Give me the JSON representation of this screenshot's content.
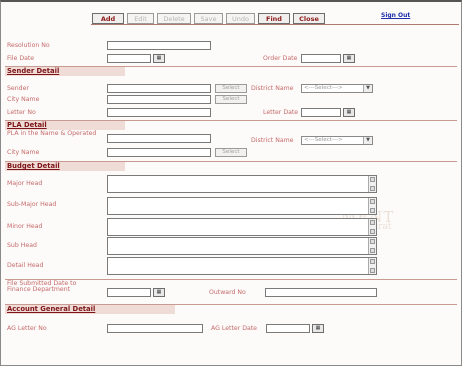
{
  "toolbar": {
    "add": "Add",
    "edit": "Edit",
    "delete": "Delete",
    "save": "Save",
    "undo": "Undo",
    "find": "Find",
    "close": "Close",
    "sign_out": "Sign Out"
  },
  "fields": {
    "resolution_no": "Resolution No",
    "file_date": "File Date",
    "order_date": "Order Date"
  },
  "sender": {
    "title": "Sender Detail",
    "sender": "Sender",
    "city_name": "City Name",
    "letter_no": "Letter No",
    "district_name": "District Name",
    "letter_date": "Letter Date",
    "select": "Select",
    "district_selected": "<---Select--->"
  },
  "pla": {
    "title": "PLA Detail",
    "name_operated": "PLA in the Name & Operated",
    "city_name": "City Name",
    "district_name": "District Name",
    "select": "Select",
    "district_selected": "<---Select--->"
  },
  "budget": {
    "title": "Budget Detail",
    "major_head": "Major Head",
    "sub_major_head": "Sub-Major Head",
    "minor_head": "Minor Head",
    "sub_head": "Sub Head",
    "detail_head": "Detail Head",
    "file_submitted": "File Submitted Date to Finance Department",
    "outward_no": "Outward No"
  },
  "ag": {
    "title": "Account General Detail",
    "letter_no": "AG Letter No",
    "letter_date": "AG Letter Date"
  },
  "watermark": {
    "line1": "MENT",
    "line2": "Gujarat"
  },
  "icons": {
    "calendar": "calendar-icon",
    "dropdown": "chevron-down-icon"
  }
}
